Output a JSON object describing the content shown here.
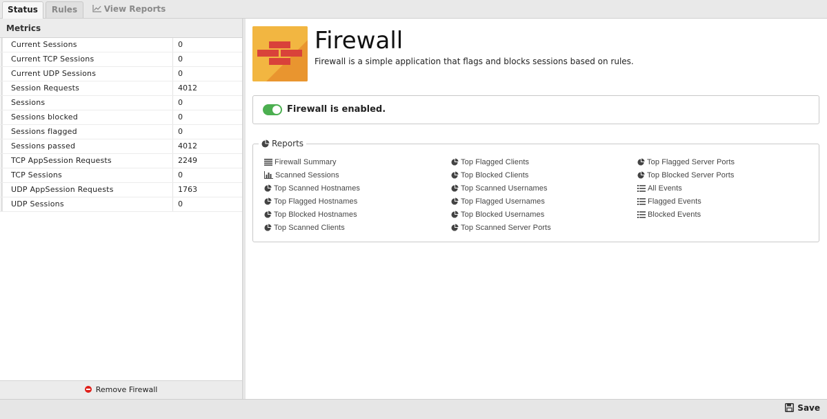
{
  "tabs": [
    {
      "label": "Status",
      "active": true
    },
    {
      "label": "Rules",
      "active": false
    },
    {
      "label": "View Reports",
      "active": false,
      "icon": "line-chart-icon"
    }
  ],
  "metrics": {
    "header": "Metrics",
    "rows": [
      {
        "name": "Current Sessions",
        "value": "0"
      },
      {
        "name": "Current TCP Sessions",
        "value": "0"
      },
      {
        "name": "Current UDP Sessions",
        "value": "0"
      },
      {
        "name": "Session Requests",
        "value": "4012"
      },
      {
        "name": "Sessions",
        "value": "0"
      },
      {
        "name": "Sessions blocked",
        "value": "0"
      },
      {
        "name": "Sessions flagged",
        "value": "0"
      },
      {
        "name": "Sessions passed",
        "value": "4012"
      },
      {
        "name": "TCP AppSession Requests",
        "value": "2249"
      },
      {
        "name": "TCP Sessions",
        "value": "0"
      },
      {
        "name": "UDP AppSession Requests",
        "value": "1763"
      },
      {
        "name": "UDP Sessions",
        "value": "0"
      }
    ],
    "remove_label": "Remove Firewall"
  },
  "app": {
    "title": "Firewall",
    "description": "Firewall is a simple application that flags and blocks sessions based on rules.",
    "status_text": "Firewall is enabled.",
    "enabled": true,
    "icon": "firewall-brick-icon",
    "icon_bg": "#f2b641"
  },
  "reports": {
    "title": "Reports",
    "columns": [
      [
        {
          "label": "Firewall Summary",
          "icon": "text-lines-icon"
        },
        {
          "label": "Scanned Sessions",
          "icon": "bar-chart-icon"
        },
        {
          "label": "Top Scanned Hostnames",
          "icon": "pie-chart-icon"
        },
        {
          "label": "Top Flagged Hostnames",
          "icon": "pie-chart-icon"
        },
        {
          "label": "Top Blocked Hostnames",
          "icon": "pie-chart-icon"
        },
        {
          "label": "Top Scanned Clients",
          "icon": "pie-chart-icon"
        }
      ],
      [
        {
          "label": "Top Flagged Clients",
          "icon": "pie-chart-icon"
        },
        {
          "label": "Top Blocked Clients",
          "icon": "pie-chart-icon"
        },
        {
          "label": "Top Scanned Usernames",
          "icon": "pie-chart-icon"
        },
        {
          "label": "Top Flagged Usernames",
          "icon": "pie-chart-icon"
        },
        {
          "label": "Top Blocked Usernames",
          "icon": "pie-chart-icon"
        },
        {
          "label": "Top Scanned Server Ports",
          "icon": "pie-chart-icon"
        }
      ],
      [
        {
          "label": "Top Flagged Server Ports",
          "icon": "pie-chart-icon"
        },
        {
          "label": "Top Blocked Server Ports",
          "icon": "pie-chart-icon"
        },
        {
          "label": "All Events",
          "icon": "list-icon"
        },
        {
          "label": "Flagged Events",
          "icon": "list-icon"
        },
        {
          "label": "Blocked Events",
          "icon": "list-icon"
        }
      ]
    ]
  },
  "footer": {
    "save_label": "Save"
  },
  "colors": {
    "toggle_on": "#4caf50",
    "remove": "#e0201a",
    "brick": "#d9423a"
  }
}
